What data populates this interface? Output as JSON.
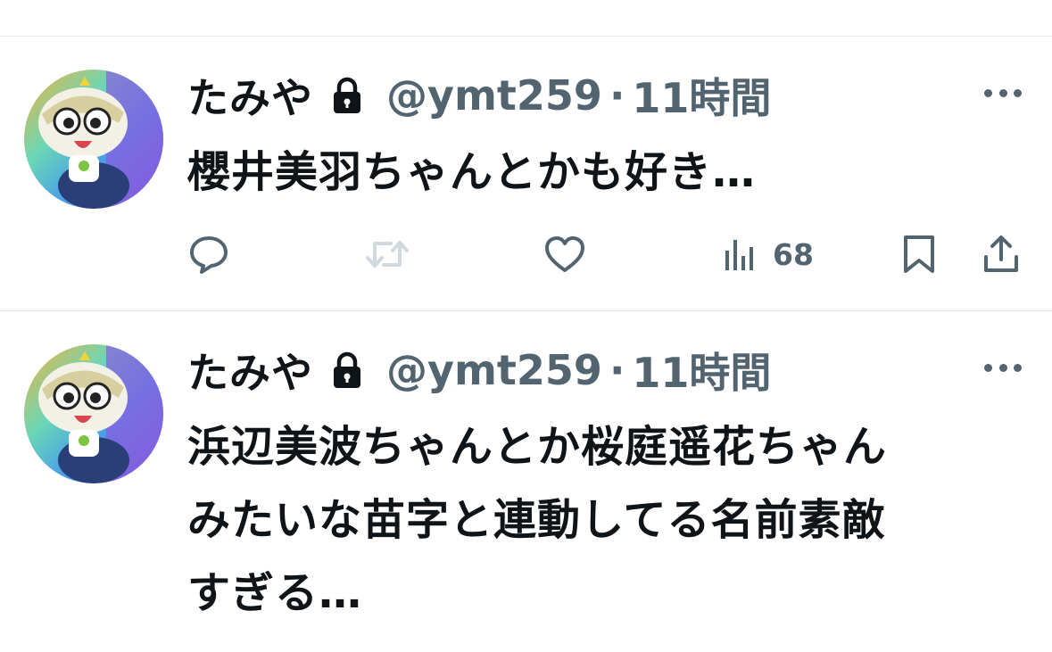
{
  "tweets": [
    {
      "name": "たみや",
      "handle": "@ymt259",
      "separator": "·",
      "time": "11時間",
      "lines": [
        "櫻井美羽ちゃんとかも好き…"
      ],
      "views": "68"
    },
    {
      "name": "たみや",
      "handle": "@ymt259",
      "separator": "·",
      "time": "11時間",
      "lines": [
        "浜辺美波ちゃんとか桜庭遥花ちゃん",
        "みたいな苗字と連動してる名前素敵",
        "すぎる…"
      ]
    }
  ],
  "icons": {
    "lock": "lock-icon",
    "more": "more-icon",
    "reply": "reply-icon",
    "retweet": "retweet-icon",
    "like": "heart-icon",
    "views": "views-icon",
    "bookmark": "bookmark-icon",
    "share": "share-icon"
  },
  "colors": {
    "text": "#0f1419",
    "secondary": "#536471",
    "divider": "#e6e9ec",
    "retweet_disabled": "#cfd9de"
  }
}
